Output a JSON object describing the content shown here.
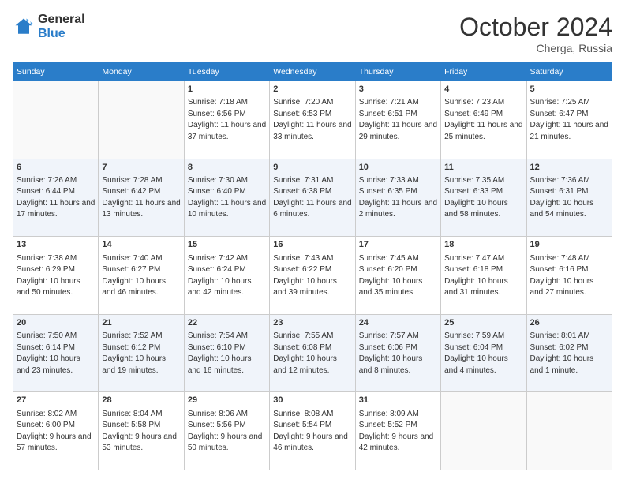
{
  "header": {
    "logo_general": "General",
    "logo_blue": "Blue",
    "month_title": "October 2024",
    "location": "Cherga, Russia"
  },
  "days_of_week": [
    "Sunday",
    "Monday",
    "Tuesday",
    "Wednesday",
    "Thursday",
    "Friday",
    "Saturday"
  ],
  "weeks": [
    [
      {
        "day": "",
        "info": ""
      },
      {
        "day": "",
        "info": ""
      },
      {
        "day": "1",
        "info": "Sunrise: 7:18 AM\nSunset: 6:56 PM\nDaylight: 11 hours and 37 minutes."
      },
      {
        "day": "2",
        "info": "Sunrise: 7:20 AM\nSunset: 6:53 PM\nDaylight: 11 hours and 33 minutes."
      },
      {
        "day": "3",
        "info": "Sunrise: 7:21 AM\nSunset: 6:51 PM\nDaylight: 11 hours and 29 minutes."
      },
      {
        "day": "4",
        "info": "Sunrise: 7:23 AM\nSunset: 6:49 PM\nDaylight: 11 hours and 25 minutes."
      },
      {
        "day": "5",
        "info": "Sunrise: 7:25 AM\nSunset: 6:47 PM\nDaylight: 11 hours and 21 minutes."
      }
    ],
    [
      {
        "day": "6",
        "info": "Sunrise: 7:26 AM\nSunset: 6:44 PM\nDaylight: 11 hours and 17 minutes."
      },
      {
        "day": "7",
        "info": "Sunrise: 7:28 AM\nSunset: 6:42 PM\nDaylight: 11 hours and 13 minutes."
      },
      {
        "day": "8",
        "info": "Sunrise: 7:30 AM\nSunset: 6:40 PM\nDaylight: 11 hours and 10 minutes."
      },
      {
        "day": "9",
        "info": "Sunrise: 7:31 AM\nSunset: 6:38 PM\nDaylight: 11 hours and 6 minutes."
      },
      {
        "day": "10",
        "info": "Sunrise: 7:33 AM\nSunset: 6:35 PM\nDaylight: 11 hours and 2 minutes."
      },
      {
        "day": "11",
        "info": "Sunrise: 7:35 AM\nSunset: 6:33 PM\nDaylight: 10 hours and 58 minutes."
      },
      {
        "day": "12",
        "info": "Sunrise: 7:36 AM\nSunset: 6:31 PM\nDaylight: 10 hours and 54 minutes."
      }
    ],
    [
      {
        "day": "13",
        "info": "Sunrise: 7:38 AM\nSunset: 6:29 PM\nDaylight: 10 hours and 50 minutes."
      },
      {
        "day": "14",
        "info": "Sunrise: 7:40 AM\nSunset: 6:27 PM\nDaylight: 10 hours and 46 minutes."
      },
      {
        "day": "15",
        "info": "Sunrise: 7:42 AM\nSunset: 6:24 PM\nDaylight: 10 hours and 42 minutes."
      },
      {
        "day": "16",
        "info": "Sunrise: 7:43 AM\nSunset: 6:22 PM\nDaylight: 10 hours and 39 minutes."
      },
      {
        "day": "17",
        "info": "Sunrise: 7:45 AM\nSunset: 6:20 PM\nDaylight: 10 hours and 35 minutes."
      },
      {
        "day": "18",
        "info": "Sunrise: 7:47 AM\nSunset: 6:18 PM\nDaylight: 10 hours and 31 minutes."
      },
      {
        "day": "19",
        "info": "Sunrise: 7:48 AM\nSunset: 6:16 PM\nDaylight: 10 hours and 27 minutes."
      }
    ],
    [
      {
        "day": "20",
        "info": "Sunrise: 7:50 AM\nSunset: 6:14 PM\nDaylight: 10 hours and 23 minutes."
      },
      {
        "day": "21",
        "info": "Sunrise: 7:52 AM\nSunset: 6:12 PM\nDaylight: 10 hours and 19 minutes."
      },
      {
        "day": "22",
        "info": "Sunrise: 7:54 AM\nSunset: 6:10 PM\nDaylight: 10 hours and 16 minutes."
      },
      {
        "day": "23",
        "info": "Sunrise: 7:55 AM\nSunset: 6:08 PM\nDaylight: 10 hours and 12 minutes."
      },
      {
        "day": "24",
        "info": "Sunrise: 7:57 AM\nSunset: 6:06 PM\nDaylight: 10 hours and 8 minutes."
      },
      {
        "day": "25",
        "info": "Sunrise: 7:59 AM\nSunset: 6:04 PM\nDaylight: 10 hours and 4 minutes."
      },
      {
        "day": "26",
        "info": "Sunrise: 8:01 AM\nSunset: 6:02 PM\nDaylight: 10 hours and 1 minute."
      }
    ],
    [
      {
        "day": "27",
        "info": "Sunrise: 8:02 AM\nSunset: 6:00 PM\nDaylight: 9 hours and 57 minutes."
      },
      {
        "day": "28",
        "info": "Sunrise: 8:04 AM\nSunset: 5:58 PM\nDaylight: 9 hours and 53 minutes."
      },
      {
        "day": "29",
        "info": "Sunrise: 8:06 AM\nSunset: 5:56 PM\nDaylight: 9 hours and 50 minutes."
      },
      {
        "day": "30",
        "info": "Sunrise: 8:08 AM\nSunset: 5:54 PM\nDaylight: 9 hours and 46 minutes."
      },
      {
        "day": "31",
        "info": "Sunrise: 8:09 AM\nSunset: 5:52 PM\nDaylight: 9 hours and 42 minutes."
      },
      {
        "day": "",
        "info": ""
      },
      {
        "day": "",
        "info": ""
      }
    ]
  ]
}
